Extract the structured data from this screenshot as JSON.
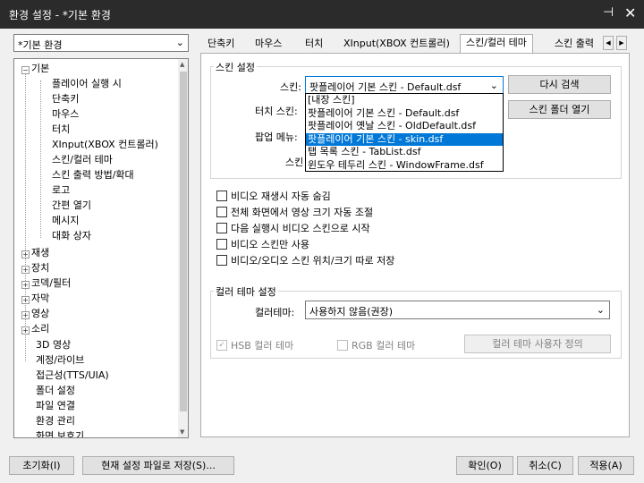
{
  "window": {
    "title": "환경 설정 - *기본 환경"
  },
  "preset": {
    "value": "*기본 환경"
  },
  "tree": {
    "items": [
      {
        "label": "기본",
        "expander": "−"
      },
      {
        "label": "플레이어 실행 시"
      },
      {
        "label": "단축키"
      },
      {
        "label": "마우스"
      },
      {
        "label": "터치"
      },
      {
        "label": "XInput(XBOX 컨트롤러)"
      },
      {
        "label": "스킨/컬러 테마"
      },
      {
        "label": "스킨 출력 방법/확대"
      },
      {
        "label": "로고"
      },
      {
        "label": "간편 열기"
      },
      {
        "label": "메시지"
      },
      {
        "label": "대화 상자"
      },
      {
        "label": "재생",
        "expander": "+"
      },
      {
        "label": "장치",
        "expander": "+"
      },
      {
        "label": "코덱/필터",
        "expander": "+"
      },
      {
        "label": "자막",
        "expander": "+"
      },
      {
        "label": "영상",
        "expander": "+"
      },
      {
        "label": "소리",
        "expander": "+"
      },
      {
        "label": "3D 영상"
      },
      {
        "label": "계정/라이브"
      },
      {
        "label": "접근성(TTS/UIA)"
      },
      {
        "label": "폴더 설정"
      },
      {
        "label": "파일 연결"
      },
      {
        "label": "환경 관리"
      },
      {
        "label": "화면 보호기"
      }
    ]
  },
  "tabs": [
    {
      "label": "단축키"
    },
    {
      "label": "마우스"
    },
    {
      "label": "터치"
    },
    {
      "label": "XInput(XBOX 컨트롤러)"
    },
    {
      "label": "스킨/컬러 테마"
    },
    {
      "label": "스킨 출력"
    }
  ],
  "skin": {
    "group_label": "스킨 설정",
    "skin_label": "스킨:",
    "skin_value": "팟플레이어 기본 스킨 - Default.dsf",
    "touch_skin_label": "터치 스킨:",
    "popup_label": "팝업 메뉴:",
    "partial_label": "스킨",
    "rescan_button": "다시 검색",
    "open_folder_button": "스킨 폴더 열기",
    "dropdown": [
      "[내장 스킨]",
      "팟플레이어 기본 스킨 - Default.dsf",
      "팟플레이어 옛날 스킨 - OldDefault.dsf",
      "팟플레이어 기본 스킨 - skin.dsf",
      "탭 목록 스킨 - TabList.dsf",
      "윈도우 테두리 스킨 - WindowFrame.dsf"
    ]
  },
  "options": [
    {
      "label": "비디오 재생시 자동 숨김"
    },
    {
      "label": "전체 화면에서 영상 크기 자동 조절"
    },
    {
      "label": "다음 실행시 비디오 스킨으로 시작"
    },
    {
      "label": "비디오 스킨만 사용"
    },
    {
      "label": "비디오/오디오 스킨 위치/크기 따로 저장"
    }
  ],
  "theme": {
    "group_label": "컬러 테마 설정",
    "label": "컬러테마:",
    "value": "사용하지 않음(권장)",
    "hsb_label": "HSB 컬러 테마",
    "rgb_label": "RGB 컬러 테마",
    "custom_button": "컬러 테마 사용자 정의"
  },
  "footer": {
    "reset": "초기화(I)",
    "save_as": "현재 설정 파일로 저장(S)...",
    "ok": "확인(O)",
    "cancel": "취소(C)",
    "apply": "적용(A)"
  },
  "colors": {
    "accent": "#0078d7",
    "titlebar": "#2b2b2b"
  }
}
